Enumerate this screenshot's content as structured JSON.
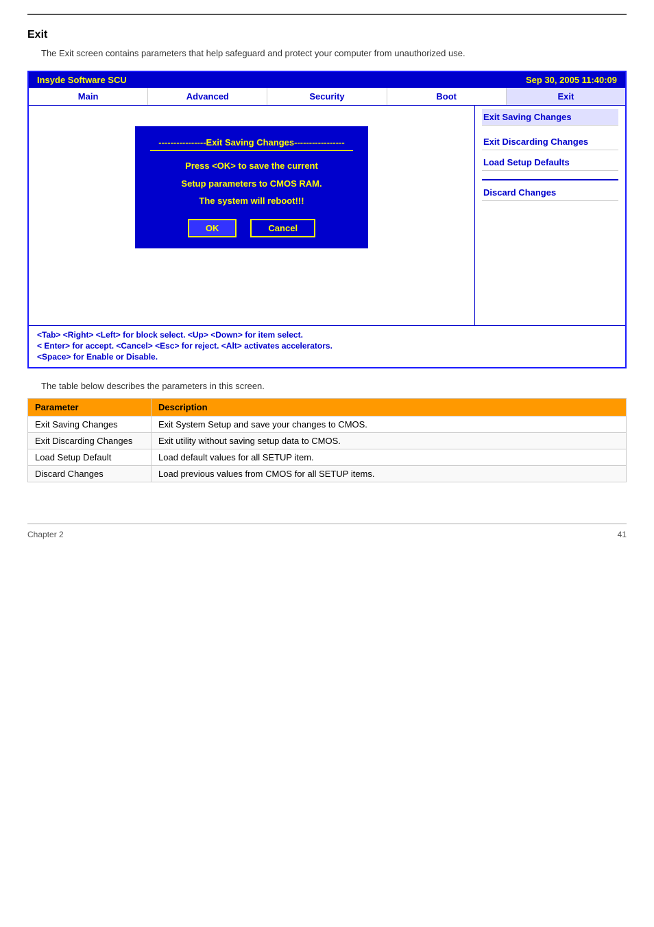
{
  "page": {
    "top_rule": true,
    "title": "Exit",
    "description": "The Exit screen contains parameters that help safeguard and protect your computer from unauthorized use."
  },
  "bios": {
    "header": {
      "left": "Insyde Software SCU",
      "right": "Sep 30, 2005 11:40:09"
    },
    "nav": [
      {
        "label": "Main"
      },
      {
        "label": "Advanced"
      },
      {
        "label": "Security"
      },
      {
        "label": "Boot"
      },
      {
        "label": "Exit"
      }
    ],
    "sidebar": [
      {
        "label": "Exit Saving Changes",
        "active": true
      },
      {
        "label": "Exit Discarding Changes"
      },
      {
        "label": "Load Setup Defaults"
      },
      {
        "label": "Discard Changes"
      }
    ],
    "dialog": {
      "title": "----------------Exit Saving Changes-----------------",
      "lines": [
        "Press  <OK>  to  save  the current",
        "Setup parameters to CMOS RAM.",
        "The system will reboot!!!"
      ],
      "ok_label": "OK",
      "cancel_label": "Cancel"
    },
    "footer": [
      "<Tab> <Right> <Left> for block select.    <Up> <Down> for item select.",
      "< Enter> for accept. <Cancel> <Esc> for reject. <Alt> activates accelerators.",
      "<Space> for Enable or Disable."
    ]
  },
  "table": {
    "description": "The table below describes the parameters in this screen.",
    "headers": [
      "Parameter",
      "Description"
    ],
    "rows": [
      {
        "param": "Exit Saving Changes",
        "desc": "Exit System Setup and save your changes to CMOS."
      },
      {
        "param": "Exit Discarding Changes",
        "desc": "Exit utility without saving setup data to CMOS."
      },
      {
        "param": "Load Setup Default",
        "desc": "Load default values for all SETUP item."
      },
      {
        "param": "Discard Changes",
        "desc": "Load previous values from CMOS for all SETUP items."
      }
    ]
  },
  "footer": {
    "left": "Chapter 2",
    "right": "41"
  }
}
